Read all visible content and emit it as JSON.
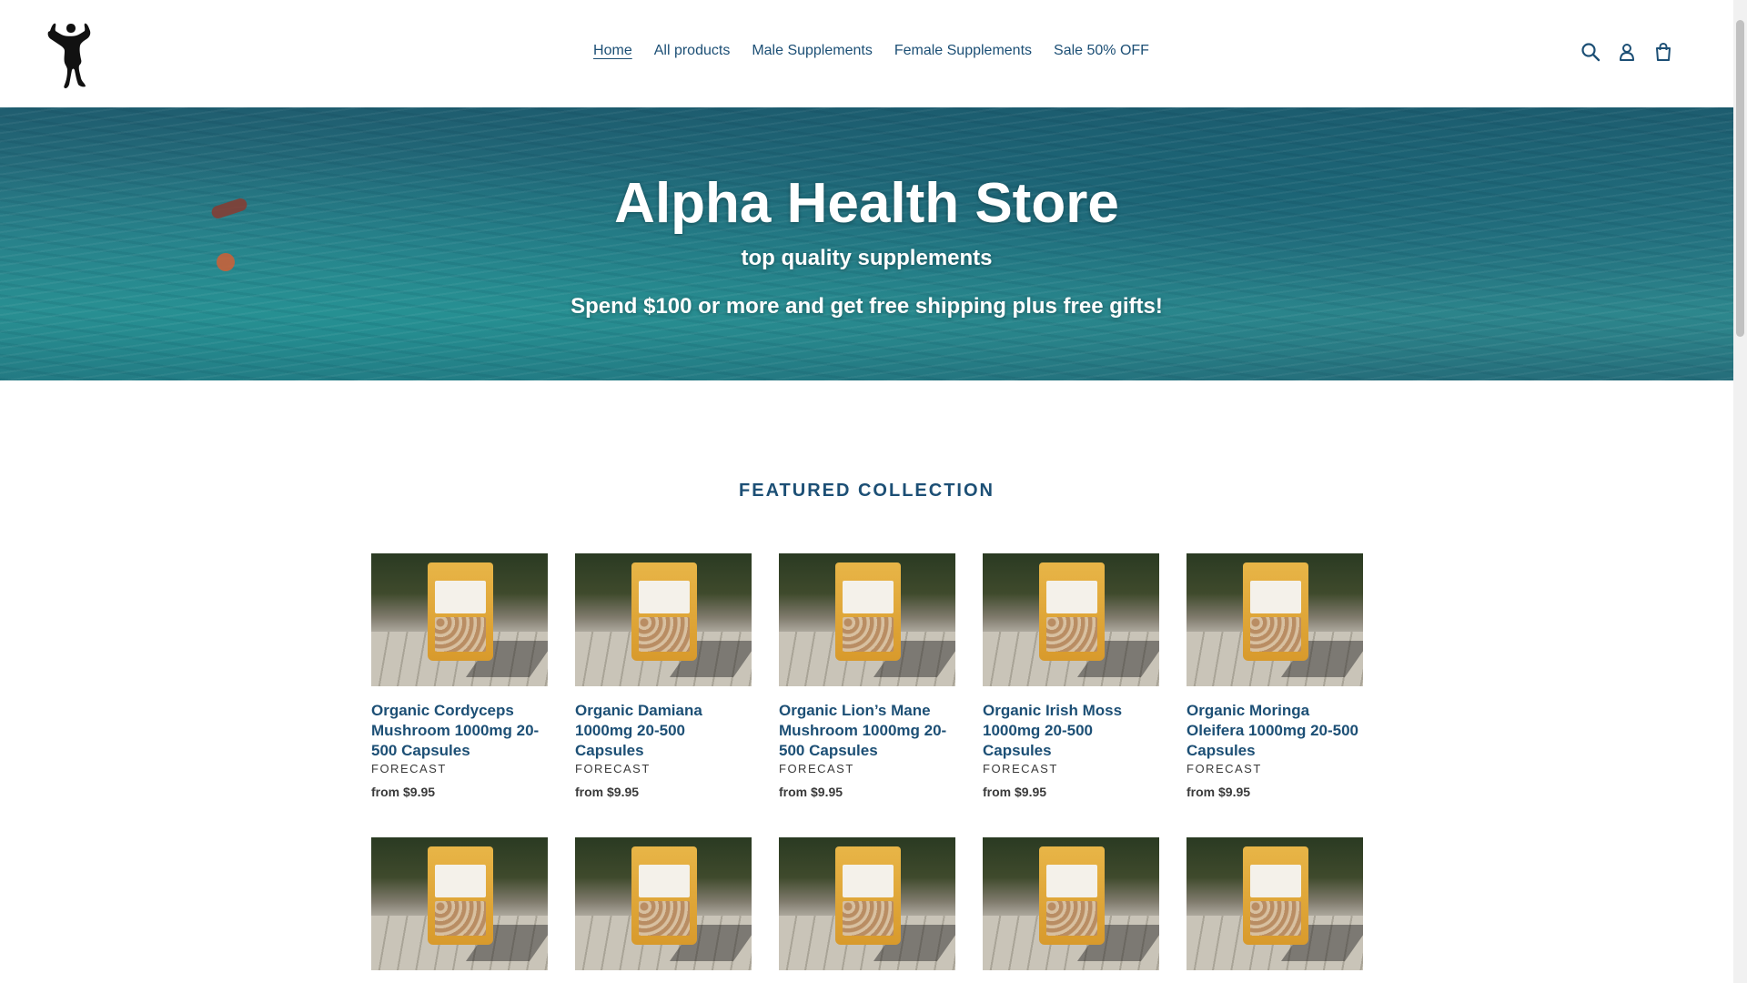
{
  "brand": {
    "logo_icon": "bodybuilder-silhouette-icon"
  },
  "nav": {
    "items": [
      {
        "label": "Home",
        "active": true
      },
      {
        "label": "All products",
        "active": false
      },
      {
        "label": "Male Supplements",
        "active": false
      },
      {
        "label": "Female Supplements",
        "active": false
      },
      {
        "label": "Sale 50% OFF",
        "active": false
      }
    ]
  },
  "header_icons": [
    "search-icon",
    "account-icon",
    "cart-icon"
  ],
  "hero": {
    "title": "Alpha Health Store",
    "subtitle": "top quality supplements",
    "promo": "Spend $100 or more and get free shipping plus free gifts!"
  },
  "featured": {
    "title": "FEATURED COLLECTION",
    "products": [
      {
        "name": "Organic Cordyceps Mushroom 1000mg 20-500 Capsules",
        "vendor": "FORECAST",
        "price": "from $9.95"
      },
      {
        "name": "Organic Damiana 1000mg 20-500 Capsules",
        "vendor": "FORECAST",
        "price": "from $9.95"
      },
      {
        "name": "Organic Lion’s Mane Mushroom 1000mg 20-500 Capsules",
        "vendor": "FORECAST",
        "price": "from $9.95"
      },
      {
        "name": "Organic Irish Moss 1000mg 20-500 Capsules",
        "vendor": "FORECAST",
        "price": "from $9.95"
      },
      {
        "name": "Organic Moringa Oleifera 1000mg 20-500 Capsules",
        "vendor": "FORECAST",
        "price": "from $9.95"
      },
      {
        "name": "",
        "vendor": "",
        "price": ""
      },
      {
        "name": "",
        "vendor": "",
        "price": ""
      },
      {
        "name": "",
        "vendor": "",
        "price": ""
      },
      {
        "name": "",
        "vendor": "",
        "price": ""
      },
      {
        "name": "",
        "vendor": "",
        "price": ""
      }
    ]
  },
  "colors": {
    "link": "#1c4f75",
    "hero_text": "#ffffff"
  }
}
